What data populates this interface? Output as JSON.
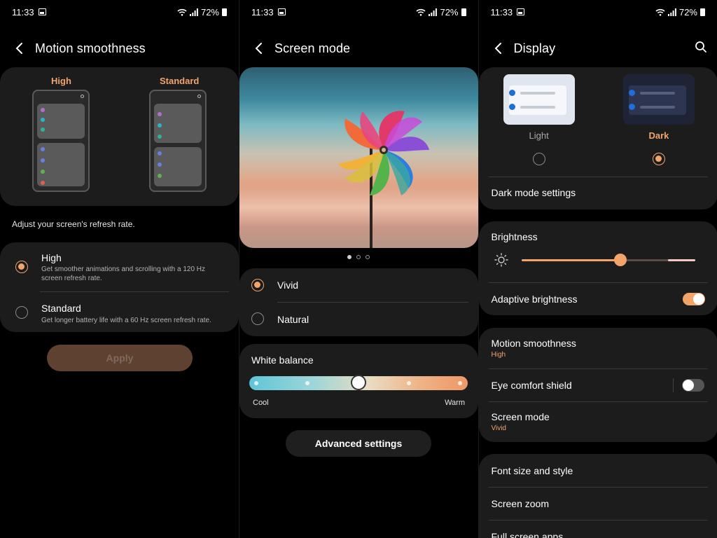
{
  "status": {
    "time": "11:33",
    "battery": "72%"
  },
  "motion": {
    "title": "Motion smoothness",
    "preview_high": "High",
    "preview_standard": "Standard",
    "description": "Adjust your screen's refresh rate.",
    "options": [
      {
        "title": "High",
        "subtitle_l1": "Get smoother animations and scrolling with a 120 Hz",
        "subtitle_l2": "screen refresh rate.",
        "selected": true
      },
      {
        "title": "Standard",
        "subtitle_l1": "Get longer battery life with a 60 Hz screen refresh rate.",
        "subtitle_l2": "",
        "selected": false
      }
    ],
    "apply_label": "Apply"
  },
  "screen_mode": {
    "title": "Screen mode",
    "pager_count": 3,
    "pager_active": 0,
    "modes": [
      {
        "label": "Vivid",
        "selected": true
      },
      {
        "label": "Natural",
        "selected": false
      }
    ],
    "white_balance": {
      "title": "White balance",
      "cool": "Cool",
      "warm": "Warm",
      "level": 0.5
    },
    "advanced_label": "Advanced settings"
  },
  "display": {
    "title": "Display",
    "themes": [
      {
        "label": "Light",
        "selected": false
      },
      {
        "label": "Dark",
        "selected": true
      }
    ],
    "dark_mode_settings": "Dark mode settings",
    "brightness": {
      "label": "Brightness",
      "level": 0.57
    },
    "adaptive_brightness": {
      "label": "Adaptive brightness",
      "on": true
    },
    "motion_smoothness": {
      "label": "Motion smoothness",
      "value": "High"
    },
    "eye_comfort": {
      "label": "Eye comfort shield",
      "on": false
    },
    "screen_mode": {
      "label": "Screen mode",
      "value": "Vivid"
    },
    "font_size": "Font size and style",
    "screen_zoom": "Screen zoom",
    "full_screen_apps": "Full screen apps"
  },
  "colors": {
    "accent": "#f2a46b",
    "card": "#1c1c1c",
    "background": "#000000"
  }
}
